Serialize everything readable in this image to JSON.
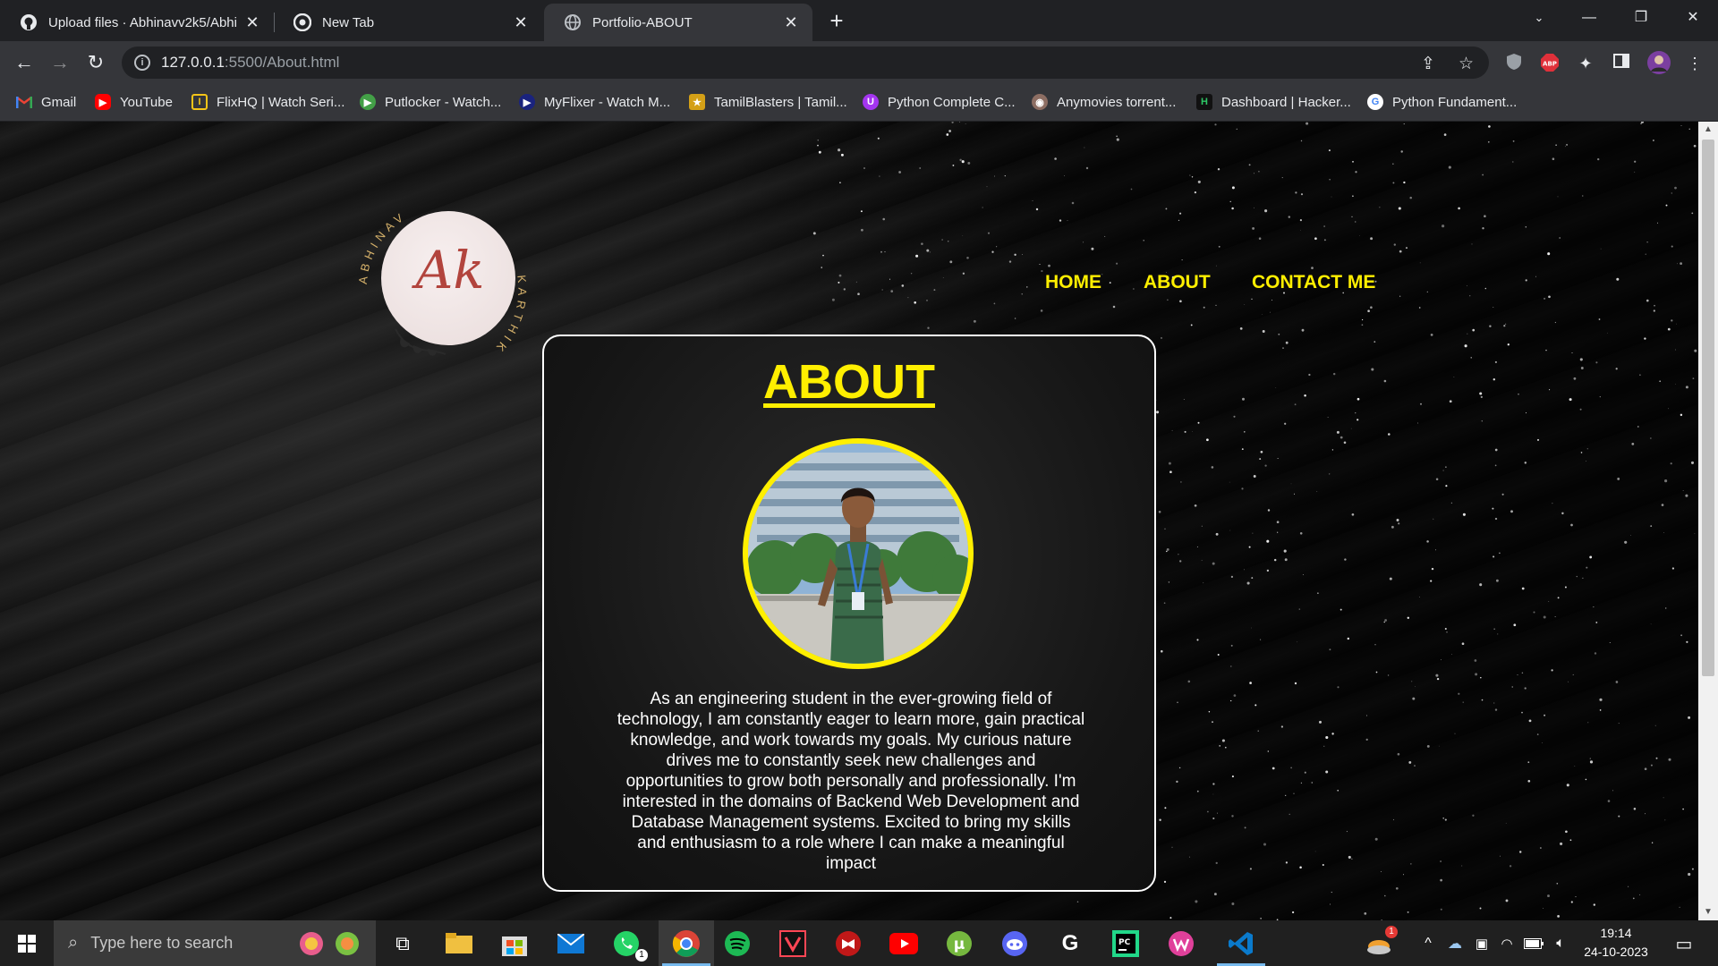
{
  "browser": {
    "tabs": [
      {
        "title": "Upload files · Abhinavv2k5/Abhi",
        "icon": "github-icon",
        "active": false
      },
      {
        "title": "New Tab",
        "icon": "chrome-icon",
        "active": false
      },
      {
        "title": "Portfolio-ABOUT",
        "icon": "globe-icon",
        "active": true
      }
    ],
    "url_host": "127.0.0.1",
    "url_path": ":5500/About.html",
    "bookmarks": [
      {
        "label": "Gmail",
        "icon": "gmail-icon",
        "color": "#ea4335"
      },
      {
        "label": "YouTube",
        "icon": "youtube-icon",
        "color": "#ff0000"
      },
      {
        "label": "FlixHQ | Watch Seri...",
        "icon": "flixhq-icon",
        "color": "#f5c518"
      },
      {
        "label": "Putlocker - Watch...",
        "icon": "putlocker-icon",
        "color": "#43a047"
      },
      {
        "label": "MyFlixer - Watch M...",
        "icon": "myflixer-icon",
        "color": "#1565c0"
      },
      {
        "label": "TamilBlasters | Tamil...",
        "icon": "tamilblasters-icon",
        "color": "#d4a017"
      },
      {
        "label": "Python Complete C...",
        "icon": "udemy-icon",
        "color": "#a435f0"
      },
      {
        "label": "Anymovies torrent...",
        "icon": "anymovies-icon",
        "color": "#8d6e63"
      },
      {
        "label": "Dashboard | Hacker...",
        "icon": "hackerrank-icon",
        "color": "#2ec866"
      },
      {
        "label": "Python Fundament...",
        "icon": "google-icon",
        "color": "#4285f4"
      }
    ]
  },
  "page": {
    "logo_text": "Ak",
    "logo_top_text": "ABHINAV",
    "logo_side_text": "KARTHIK",
    "nav": {
      "home": "HOME",
      "about": "ABOUT",
      "contact": "CONTACT ME"
    },
    "heading": "ABOUT",
    "about_text": "As an engineering student in the ever-growing field of technology, I am constantly eager to learn more, gain practical knowledge, and work towards my goals. My curious nature drives me to constantly seek new challenges and opportunities to grow both personally and professionally. I'm interested in the domains of Backend Web Development and Database Management systems. Excited to bring my skills and enthusiasm to a role where I can make a meaningful impact",
    "accent_color": "#ffef00"
  },
  "taskbar": {
    "search_placeholder": "Type here to search",
    "whatsapp_badge": "1",
    "weather_badge": "1",
    "time": "19:14",
    "date": "24-10-2023"
  }
}
